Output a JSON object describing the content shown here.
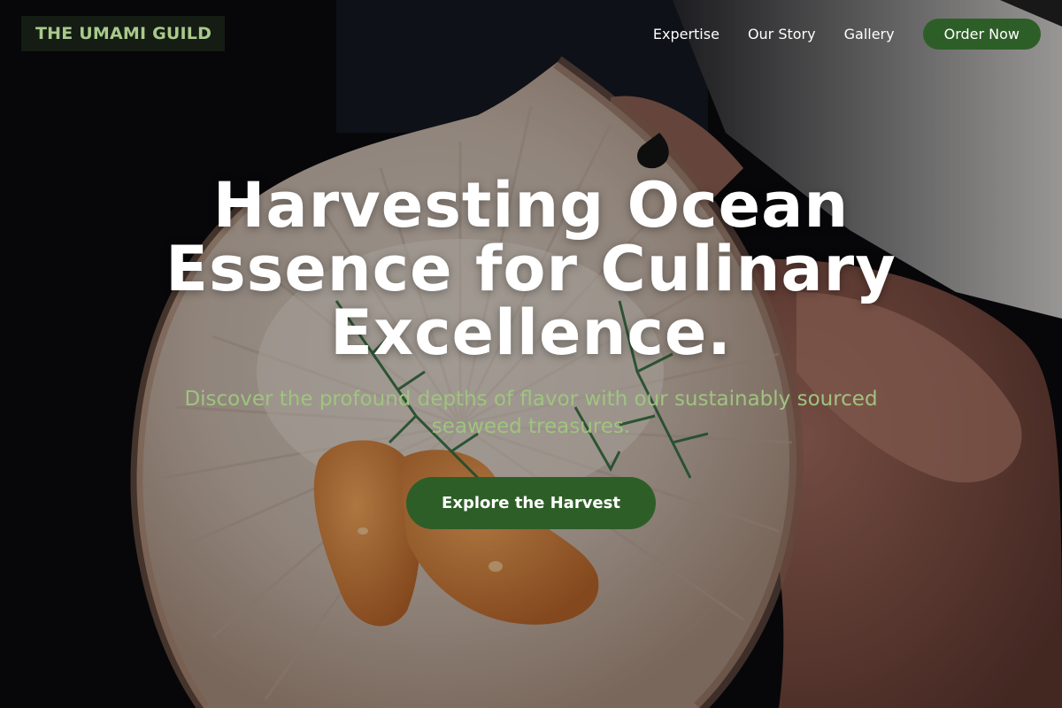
{
  "header": {
    "logo_text": "THE UMAMI GUILD",
    "nav": [
      {
        "label": "Expertise"
      },
      {
        "label": "Our Story"
      },
      {
        "label": "Gallery"
      }
    ],
    "order_label": "Order Now"
  },
  "hero": {
    "title": "Harvesting Ocean Essence for Culinary Excellence.",
    "subtitle": "Discover the profound depths of flavor with our sustainably sourced seaweed treasures.",
    "cta_label": "Explore the Harvest"
  },
  "colors": {
    "brand_green": "#2e5e28",
    "logo_green": "#a9c98c",
    "subtitle_green": "#9fc47e",
    "background": "#0b0b0d"
  }
}
